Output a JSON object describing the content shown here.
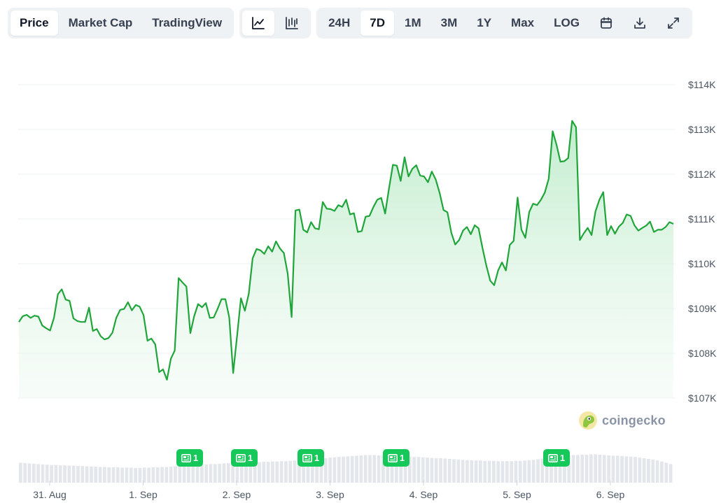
{
  "toolbar": {
    "metric_tabs": [
      {
        "label": "Price",
        "active": true
      },
      {
        "label": "Market Cap",
        "active": false
      },
      {
        "label": "TradingView",
        "active": false
      }
    ],
    "chart_type_icons": [
      {
        "icon": "line-chart-icon",
        "active": true
      },
      {
        "icon": "candlestick-chart-icon",
        "active": false
      }
    ],
    "ranges": [
      {
        "label": "24H",
        "active": false
      },
      {
        "label": "7D",
        "active": true
      },
      {
        "label": "1M",
        "active": false
      },
      {
        "label": "3M",
        "active": false
      },
      {
        "label": "1Y",
        "active": false
      },
      {
        "label": "Max",
        "active": false
      },
      {
        "label": "LOG",
        "active": false
      }
    ],
    "tool_icons": [
      "calendar-icon",
      "download-icon",
      "expand-icon"
    ]
  },
  "watermark": {
    "text": "coingecko",
    "icon": "coingecko-logo-icon"
  },
  "news_markers": [
    {
      "count": "1",
      "date": "1. Sep"
    },
    {
      "count": "1",
      "date": "2. Sep"
    },
    {
      "count": "1",
      "date": "3. Sep"
    },
    {
      "count": "1",
      "date": "4. Sep"
    },
    {
      "count": "1",
      "date": "5. Sep"
    }
  ],
  "colors": {
    "line": "#1fa53a",
    "fill_top": "#c9efd3",
    "volume": "#e3e6ea",
    "news": "#16c75a"
  },
  "chart_data": {
    "type": "area",
    "title": "",
    "xlabel": "",
    "ylabel": "",
    "x_tick_labels": [
      "31. Aug",
      "1. Sep",
      "2. Sep",
      "3. Sep",
      "4. Sep",
      "5. Sep",
      "6. Sep"
    ],
    "y_tick_labels": [
      "$107K",
      "$108K",
      "$109K",
      "$110K",
      "$111K",
      "$112K",
      "$113K",
      "$114K"
    ],
    "ylim": [
      107000,
      114000
    ],
    "xlim_days": [
      0,
      7
    ],
    "grid": true,
    "y_axis_position": "right",
    "series": [
      {
        "values": [
          [
            0.0,
            108700
          ],
          [
            0.05,
            108830
          ],
          [
            0.1,
            108860
          ],
          [
            0.15,
            108790
          ],
          [
            0.2,
            108840
          ],
          [
            0.25,
            108820
          ],
          [
            0.3,
            108620
          ],
          [
            0.35,
            108560
          ],
          [
            0.4,
            108510
          ],
          [
            0.45,
            108790
          ],
          [
            0.5,
            109320
          ],
          [
            0.55,
            109430
          ],
          [
            0.6,
            109200
          ],
          [
            0.65,
            109170
          ],
          [
            0.7,
            108780
          ],
          [
            0.75,
            108720
          ],
          [
            0.8,
            108700
          ],
          [
            0.85,
            108700
          ],
          [
            0.9,
            109020
          ],
          [
            0.95,
            108500
          ],
          [
            1.0,
            108540
          ],
          [
            1.05,
            108380
          ],
          [
            1.1,
            108310
          ],
          [
            1.15,
            108340
          ],
          [
            1.2,
            108460
          ],
          [
            1.25,
            108790
          ],
          [
            1.3,
            108970
          ],
          [
            1.35,
            108990
          ],
          [
            1.4,
            109140
          ],
          [
            1.45,
            108960
          ],
          [
            1.5,
            109080
          ],
          [
            1.55,
            109040
          ],
          [
            1.6,
            108850
          ],
          [
            1.65,
            108280
          ],
          [
            1.7,
            108330
          ],
          [
            1.75,
            108200
          ],
          [
            1.8,
            107580
          ],
          [
            1.85,
            107640
          ],
          [
            1.9,
            107410
          ],
          [
            1.95,
            107880
          ],
          [
            2.0,
            108060
          ],
          [
            2.05,
            109680
          ],
          [
            2.1,
            109580
          ],
          [
            2.15,
            109490
          ],
          [
            2.2,
            108450
          ],
          [
            2.25,
            108830
          ],
          [
            2.3,
            109100
          ],
          [
            2.35,
            109030
          ],
          [
            2.4,
            109120
          ],
          [
            2.45,
            108790
          ],
          [
            2.5,
            108800
          ],
          [
            2.55,
            108990
          ],
          [
            2.6,
            109210
          ],
          [
            2.65,
            109210
          ],
          [
            2.7,
            108800
          ],
          [
            2.75,
            107560
          ],
          [
            2.8,
            108390
          ],
          [
            2.85,
            109230
          ],
          [
            2.9,
            108950
          ],
          [
            2.95,
            109330
          ],
          [
            3.0,
            110120
          ],
          [
            3.05,
            110330
          ],
          [
            3.1,
            110300
          ],
          [
            3.15,
            110220
          ],
          [
            3.2,
            110390
          ],
          [
            3.25,
            110270
          ],
          [
            3.3,
            110500
          ],
          [
            3.35,
            110340
          ],
          [
            3.4,
            110240
          ],
          [
            3.45,
            109780
          ],
          [
            3.5,
            108810
          ],
          [
            3.55,
            111190
          ],
          [
            3.6,
            111210
          ],
          [
            3.65,
            110760
          ],
          [
            3.7,
            110700
          ],
          [
            3.75,
            110930
          ],
          [
            3.8,
            110790
          ],
          [
            3.85,
            110770
          ],
          [
            3.9,
            111380
          ],
          [
            3.95,
            111230
          ],
          [
            4.0,
            111220
          ],
          [
            4.05,
            111180
          ],
          [
            4.1,
            111310
          ],
          [
            4.15,
            111270
          ],
          [
            4.2,
            111430
          ],
          [
            4.25,
            111100
          ],
          [
            4.3,
            111130
          ],
          [
            4.35,
            110710
          ],
          [
            4.4,
            110730
          ],
          [
            4.45,
            111050
          ],
          [
            4.5,
            111070
          ],
          [
            4.55,
            111270
          ],
          [
            4.6,
            111430
          ],
          [
            4.65,
            111470
          ],
          [
            4.7,
            111120
          ],
          [
            4.75,
            111680
          ],
          [
            4.8,
            112210
          ],
          [
            4.85,
            112190
          ],
          [
            4.9,
            111850
          ],
          [
            4.95,
            112380
          ],
          [
            5.0,
            111950
          ],
          [
            5.05,
            112120
          ],
          [
            5.1,
            112200
          ],
          [
            5.15,
            111970
          ],
          [
            5.2,
            111950
          ],
          [
            5.25,
            111820
          ],
          [
            5.3,
            112060
          ],
          [
            5.35,
            111880
          ],
          [
            5.4,
            111580
          ],
          [
            5.45,
            111200
          ],
          [
            5.5,
            111150
          ],
          [
            5.55,
            110690
          ],
          [
            5.6,
            110430
          ],
          [
            5.65,
            110530
          ],
          [
            5.7,
            110740
          ],
          [
            5.75,
            110820
          ],
          [
            5.8,
            110660
          ],
          [
            5.85,
            110860
          ],
          [
            5.9,
            110790
          ],
          [
            5.95,
            110350
          ],
          [
            6.0,
            109950
          ],
          [
            6.05,
            109620
          ],
          [
            6.1,
            109520
          ],
          [
            6.15,
            109850
          ],
          [
            6.2,
            110030
          ],
          [
            6.25,
            109850
          ],
          [
            6.3,
            110420
          ],
          [
            6.35,
            110510
          ],
          [
            6.4,
            111480
          ],
          [
            6.45,
            110760
          ],
          [
            6.5,
            110580
          ],
          [
            6.55,
            111160
          ],
          [
            6.6,
            111340
          ],
          [
            6.65,
            111310
          ],
          [
            6.7,
            111430
          ],
          [
            6.75,
            111590
          ],
          [
            6.8,
            111900
          ],
          [
            6.85,
            112960
          ],
          [
            6.9,
            112660
          ],
          [
            6.95,
            112280
          ],
          [
            7.0,
            112290
          ],
          [
            7.05,
            112360
          ],
          [
            7.1,
            113190
          ],
          [
            7.15,
            113050
          ],
          [
            7.2,
            110530
          ],
          [
            7.25,
            110680
          ],
          [
            7.3,
            110800
          ],
          [
            7.35,
            110640
          ],
          [
            7.4,
            111170
          ],
          [
            7.45,
            111430
          ],
          [
            7.5,
            111600
          ],
          [
            7.55,
            110640
          ],
          [
            7.6,
            110840
          ],
          [
            7.65,
            110670
          ],
          [
            7.7,
            110830
          ],
          [
            7.75,
            110910
          ],
          [
            7.8,
            111100
          ],
          [
            7.85,
            111070
          ],
          [
            7.9,
            110860
          ],
          [
            7.95,
            110740
          ],
          [
            8.0,
            110800
          ],
          [
            8.05,
            110850
          ],
          [
            8.1,
            110940
          ],
          [
            8.15,
            110710
          ],
          [
            8.2,
            110760
          ],
          [
            8.25,
            110760
          ],
          [
            8.3,
            110820
          ],
          [
            8.35,
            110930
          ],
          [
            8.4,
            110890
          ]
        ]
      }
    ],
    "volume_relative": [
      0.62,
      0.61,
      0.6,
      0.59,
      0.58,
      0.57,
      0.56,
      0.55,
      0.55,
      0.54,
      0.54,
      0.53,
      0.53,
      0.52,
      0.52,
      0.51,
      0.5,
      0.5,
      0.49,
      0.49,
      0.48,
      0.48,
      0.48,
      0.47,
      0.47,
      0.47,
      0.46,
      0.46,
      0.47,
      0.47,
      0.48,
      0.48,
      0.49,
      0.49,
      0.5,
      0.51,
      0.52,
      0.53,
      0.53,
      0.54,
      0.55,
      0.56,
      0.57,
      0.58,
      0.58,
      0.59,
      0.6,
      0.61,
      0.61,
      0.62,
      0.62,
      0.63,
      0.63,
      0.64,
      0.64,
      0.65,
      0.65,
      0.66,
      0.66,
      0.67,
      0.67,
      0.68,
      0.69,
      0.7,
      0.71,
      0.72,
      0.73,
      0.74,
      0.75,
      0.76,
      0.78,
      0.79,
      0.8,
      0.81,
      0.82,
      0.83,
      0.84,
      0.85,
      0.86,
      0.86,
      0.86,
      0.85,
      0.85,
      0.84,
      0.84,
      0.83,
      0.82,
      0.82,
      0.81,
      0.8,
      0.8,
      0.79,
      0.78,
      0.77,
      0.76,
      0.76,
      0.75,
      0.74,
      0.73,
      0.72,
      0.71,
      0.7,
      0.7,
      0.69,
      0.69,
      0.68,
      0.68,
      0.68,
      0.67,
      0.67,
      0.67,
      0.67,
      0.68,
      0.68,
      0.69,
      0.7,
      0.71,
      0.73,
      0.75,
      0.77,
      0.79,
      0.81,
      0.83,
      0.84,
      0.85,
      0.86,
      0.86,
      0.87,
      0.87,
      0.88,
      0.88,
      0.87,
      0.86,
      0.85,
      0.84,
      0.84,
      0.83,
      0.82,
      0.81,
      0.8,
      0.78,
      0.76,
      0.74,
      0.72,
      0.69,
      0.66,
      0.62,
      0.58
    ]
  }
}
